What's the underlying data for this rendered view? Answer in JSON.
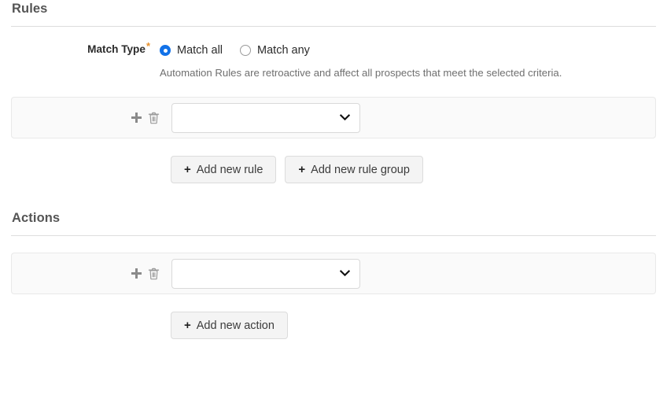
{
  "rules_section": {
    "title": "Rules",
    "match_type": {
      "label": "Match Type",
      "required_marker": "*",
      "options": [
        {
          "label": "Match all",
          "selected": true
        },
        {
          "label": "Match any",
          "selected": false
        }
      ],
      "help_text": "Automation Rules are retroactive and affect all prospects that meet the selected criteria."
    },
    "rule_row": {
      "add_icon": "plus-icon",
      "delete_icon": "trash-icon",
      "select_value": "",
      "select_placeholder": ""
    },
    "buttons": [
      {
        "plus": "+",
        "label": "Add new rule"
      },
      {
        "plus": "+",
        "label": "Add new rule group"
      }
    ]
  },
  "actions_section": {
    "title": "Actions",
    "action_row": {
      "add_icon": "plus-icon",
      "delete_icon": "trash-icon",
      "select_value": "",
      "select_placeholder": ""
    },
    "buttons": [
      {
        "plus": "+",
        "label": "Add new action"
      }
    ]
  },
  "colors": {
    "radio_accent": "#1272e8",
    "required_star": "#e8912d",
    "panel_bg": "#fafafa",
    "button_bg": "#f4f4f4",
    "heading": "#555555"
  }
}
